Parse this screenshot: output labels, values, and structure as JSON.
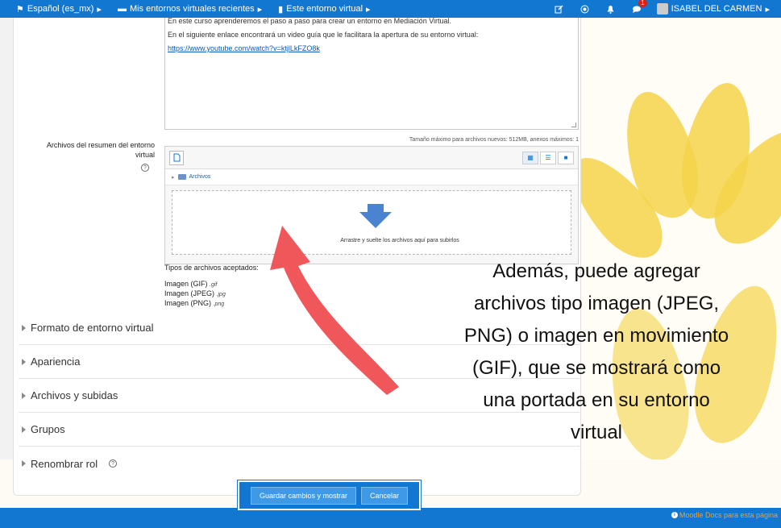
{
  "navbar": {
    "language": "Español (es_mx)",
    "recent_envs": "Mis entornos virtuales recientes",
    "this_env": "Este entorno virtual",
    "notification_count": "1",
    "user_name": "ISABEL DEL CARMEN"
  },
  "editor": {
    "line1": "En este curso aprenderemos el paso a paso para crear un entorno en Mediación Virtual.",
    "line2": "En el siguiente enlace encontrará un video guía que le facilitara la apertura de su entorno virtual:",
    "link": "https://www.youtube.com/watch?v=ktjlLkFZO8k"
  },
  "filepicker": {
    "label": "Archivos del resumen del entorno virtual",
    "max_size": "Tamaño máximo para archivos nuevos: 512MB, anexos máximos: 1",
    "path_folder": "Archivos",
    "drop_text": "Arrastre y suelte los archivos aquí para subirlos"
  },
  "accepted_types": {
    "heading": "Tipos de archivos aceptados:",
    "items": [
      {
        "name": "Imagen (GIF)",
        "ext": ".gif"
      },
      {
        "name": "Imagen (JPEG)",
        "ext": ".jpg"
      },
      {
        "name": "Imagen (PNG)",
        "ext": ".png"
      }
    ]
  },
  "sections": [
    {
      "label": "Formato de entorno virtual"
    },
    {
      "label": "Apariencia"
    },
    {
      "label": "Archivos y subidas"
    },
    {
      "label": "Grupos"
    },
    {
      "label": "Renombrar rol"
    }
  ],
  "buttons": {
    "save": "Guardar cambios y mostrar",
    "cancel": "Cancelar"
  },
  "footer": {
    "docs": "Moodle Docs para esta página"
  },
  "annotation": {
    "lines": [
      "Además, puede agregar",
      "archivos tipo imagen (JPEG,",
      "PNG) o imagen en movimiento",
      "(GIF), que se mostrará como",
      "una portada en su entorno",
      "virtual"
    ]
  },
  "colors": {
    "brand": "#1177d1",
    "arrow": "#f0575a",
    "docs_link": "#f0a030"
  }
}
